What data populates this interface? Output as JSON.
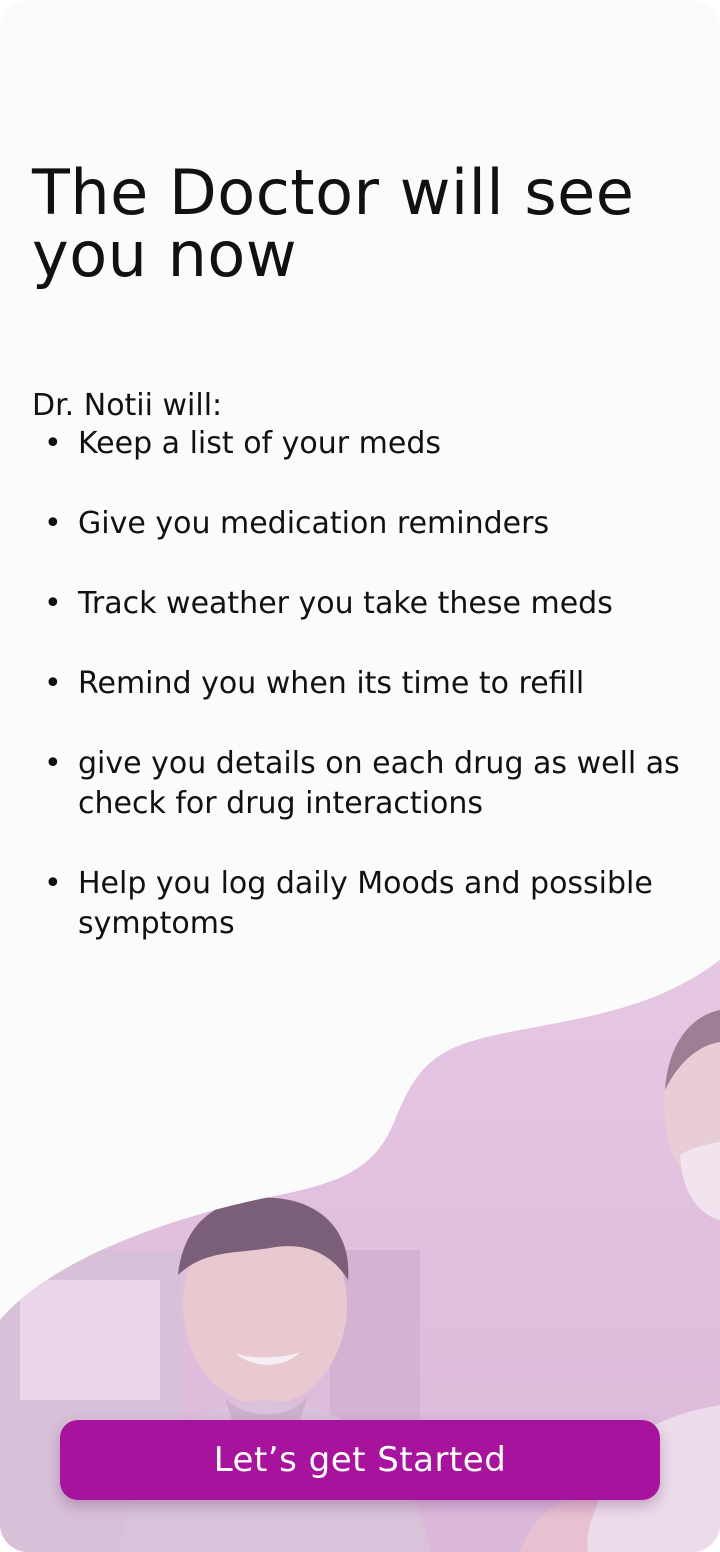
{
  "onboarding": {
    "title": "The Doctor will see you now",
    "intro": "Dr. Notii will:",
    "bullet": "•",
    "features": [
      "Keep a list of your meds",
      "Give you medication reminders",
      "Track weather you take these meds",
      "Remind you when its time to refill",
      "give you details on each drug as well as check for drug interactions",
      "Help you log daily Moods and possible symptoms"
    ],
    "cta_label": "Let’s get Started"
  },
  "colors": {
    "background": "#fbfbfc",
    "text": "#111111",
    "accent": "#a8139e",
    "overlay": "#e3c3e1"
  },
  "hero": {
    "image": "smiling-patient-with-doctor-photo"
  }
}
